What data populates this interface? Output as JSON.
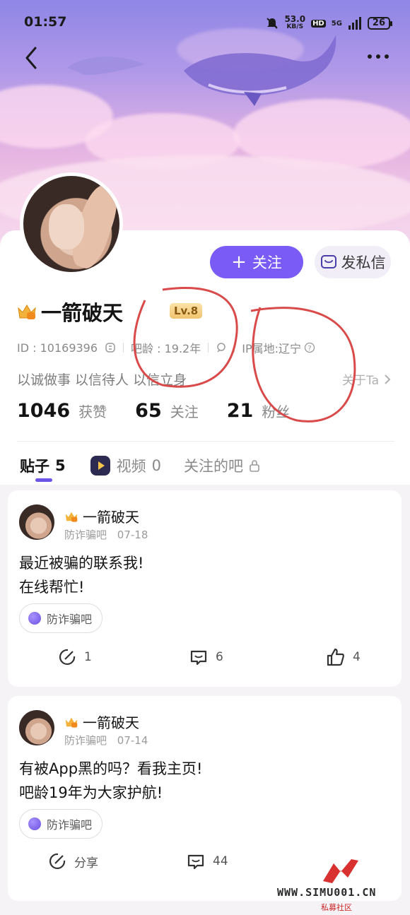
{
  "status": {
    "time": "01:57",
    "speed": "53.0",
    "speed_unit": "KB/S",
    "hd": "HD",
    "network": "5G",
    "battery": "26"
  },
  "header": {
    "back_icon": "chevron-left-icon",
    "more_icon": "more-dots-icon"
  },
  "profile": {
    "follow_label": "关注",
    "follow_plus": "+",
    "message_label": "发私信",
    "name": "一箭破天",
    "level": "Lv.8",
    "id_text": "ID : 10169396",
    "bar_age": "吧龄 : 19.2年",
    "ip": "IP属地:辽宁",
    "bio": "以诚做事 以信待人 以信立身",
    "about": "关于Ta",
    "stats": [
      {
        "num": "1046",
        "label": "获赞"
      },
      {
        "num": "65",
        "label": "关注"
      },
      {
        "num": "21",
        "label": "粉丝"
      }
    ]
  },
  "tabs": [
    {
      "label": "贴子",
      "count": "5"
    },
    {
      "label": "视频",
      "count": "0"
    },
    {
      "label": "关注的吧",
      "count": ""
    }
  ],
  "posts": [
    {
      "author": "一箭破天",
      "forum": "防诈骗吧",
      "date": "07-18",
      "lines": [
        "最近被骗的联系我!",
        "在线帮忙!"
      ],
      "tag": "防诈骗吧",
      "share": "1",
      "comments": "6",
      "likes": "4"
    },
    {
      "author": "一箭破天",
      "forum": "防诈骗吧",
      "date": "07-14",
      "lines": [
        "有被App黑的吗？看我主页!",
        "吧龄19年为大家护航!"
      ],
      "tag": "防诈骗吧",
      "share": "分享",
      "comments": "44"
    }
  ],
  "watermark": {
    "url": "WWW.SIMU001.CN",
    "sub": "私募社区"
  },
  "colors": {
    "accent": "#7a5bf5",
    "annotation": "#d94a4a"
  }
}
